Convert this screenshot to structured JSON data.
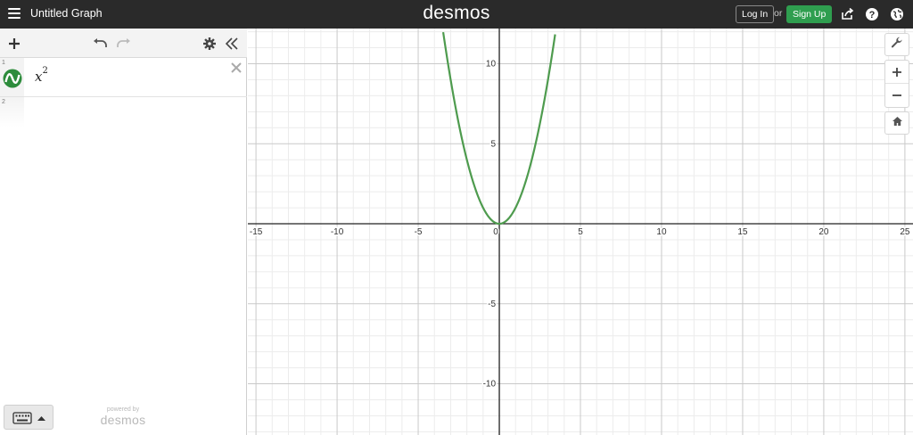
{
  "header": {
    "title": "Untitled Graph",
    "brand": "desmos",
    "login_label": "Log In",
    "or_label": "or",
    "signup_label": "Sign Up",
    "signup_color": "#2f9e4f",
    "icons": [
      "menu-icon",
      "share-icon",
      "help-icon",
      "globe-icon"
    ]
  },
  "expression_panel": {
    "toolbar_icons": [
      "add-icon",
      "undo-icon",
      "redo-icon",
      "gear-icon",
      "collapse-icon"
    ],
    "expressions": [
      {
        "index": "1",
        "base": "x",
        "exponent": "2",
        "color": "#2d8c3c"
      },
      {
        "index": "2",
        "base": "",
        "exponent": ""
      }
    ],
    "powered_small": "powered by",
    "powered_brand": "desmos",
    "keyboard_icon": "keyboard-icon"
  },
  "graph_controls": [
    "wrench-icon",
    "zoom-in-icon",
    "zoom-out-icon",
    "home-icon"
  ],
  "chart_data": {
    "type": "line",
    "series": [
      {
        "expression": "x^2",
        "color": "#4e9b4e",
        "x": [
          -3.46,
          -3,
          -2.5,
          -2,
          -1.5,
          -1,
          -0.5,
          0,
          0.5,
          1,
          1.5,
          2,
          2.5,
          3,
          3.46
        ],
        "y": [
          12,
          9,
          6.25,
          4,
          2.25,
          1,
          0.25,
          0,
          0.25,
          1,
          2.25,
          4,
          6.25,
          9,
          12
        ]
      }
    ],
    "x_ticks": [
      "-15",
      "-10",
      "-5",
      "0",
      "5",
      "10",
      "15",
      "20",
      "25"
    ],
    "y_ticks": [
      "10",
      "5",
      "-5",
      "-10"
    ],
    "xlim": [
      -15.5,
      25.5
    ],
    "ylim": [
      -13.2,
      12.2
    ],
    "grid": true
  }
}
